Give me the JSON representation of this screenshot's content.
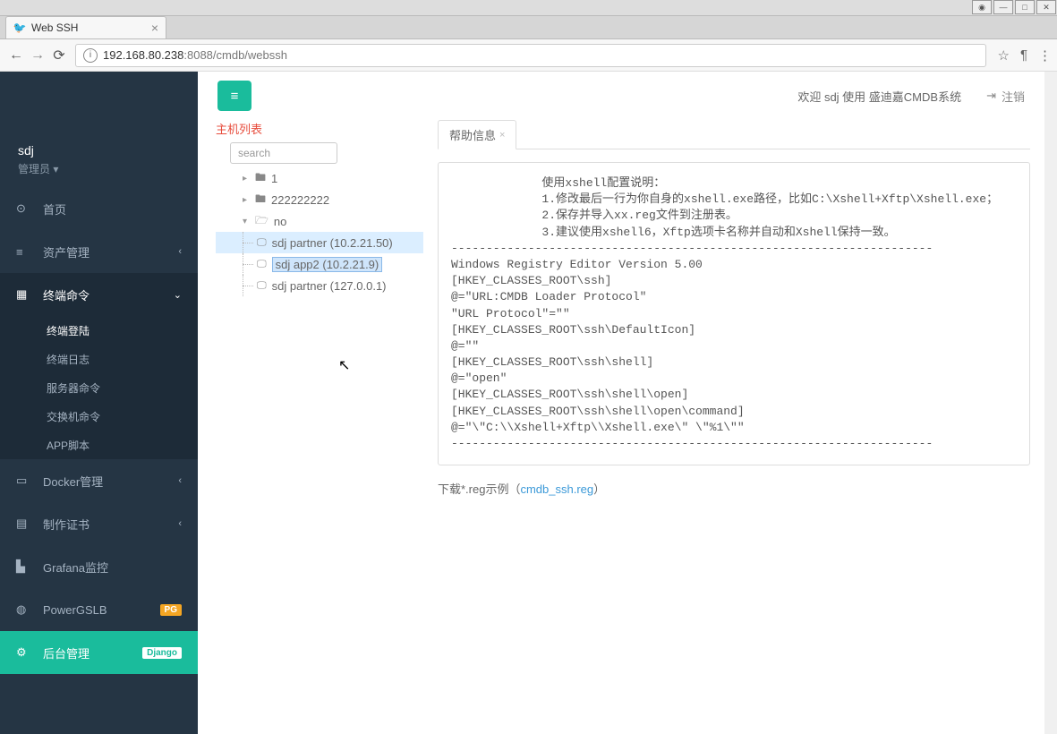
{
  "browser": {
    "tab_title": "Web SSH",
    "url_host": "192.168.80.238",
    "url_port_path": ":8088/cmdb/webssh"
  },
  "user": {
    "name": "sdj",
    "role": "管理员 ▾"
  },
  "nav": {
    "home": "首页",
    "asset": "资产管理",
    "terminal": "终端命令",
    "terminal_subs": [
      "终端登陆",
      "终端日志",
      "服务器命令",
      "交换机命令",
      "APP脚本"
    ],
    "docker": "Docker管理",
    "cert": "制作证书",
    "grafana": "Grafana监控",
    "powergslb": "PowerGSLB",
    "powergslb_badge": "PG",
    "backend": "后台管理",
    "backend_badge": "Django"
  },
  "topbar": {
    "welcome": "欢迎 sdj 使用 盛迪嘉CMDB系统",
    "logout": "注销"
  },
  "hostlist": {
    "title": "主机列表",
    "search_placeholder": "search",
    "tree": {
      "n1": "1",
      "n2": "222222222",
      "n3": "no",
      "hosts": [
        "sdj partner (10.2.21.50)",
        "sdj app2 (10.2.21.9)",
        "sdj partner (127.0.0.1)"
      ]
    }
  },
  "panel": {
    "tab": "帮助信息",
    "help_body": "             使用xshell配置说明：\n             1.修改最后一行为你自身的xshell.exe路径，比如C:\\Xshell+Xftp\\Xshell.exe；\n             2.保存并导入xx.reg文件到注册表。\n             3.建议使用xshell6，Xftp选项卡名称并自动和Xshell保持一致。\n---------------------------------------------------------------------\nWindows Registry Editor Version 5.00\n[HKEY_CLASSES_ROOT\\ssh]\n@=\"URL:CMDB Loader Protocol\"\n\"URL Protocol\"=\"\"\n[HKEY_CLASSES_ROOT\\ssh\\DefaultIcon]\n@=\"\"\n[HKEY_CLASSES_ROOT\\ssh\\shell]\n@=\"open\"\n[HKEY_CLASSES_ROOT\\ssh\\shell\\open]\n[HKEY_CLASSES_ROOT\\ssh\\shell\\open\\command]\n@=\"\\\"C:\\\\Xshell+Xftp\\\\Xshell.exe\\\" \\\"%1\\\"\"\n---------------------------------------------------------------------",
    "download_prefix": "下载*.reg示例（",
    "download_link": "cmdb_ssh.reg",
    "download_suffix": "）"
  }
}
